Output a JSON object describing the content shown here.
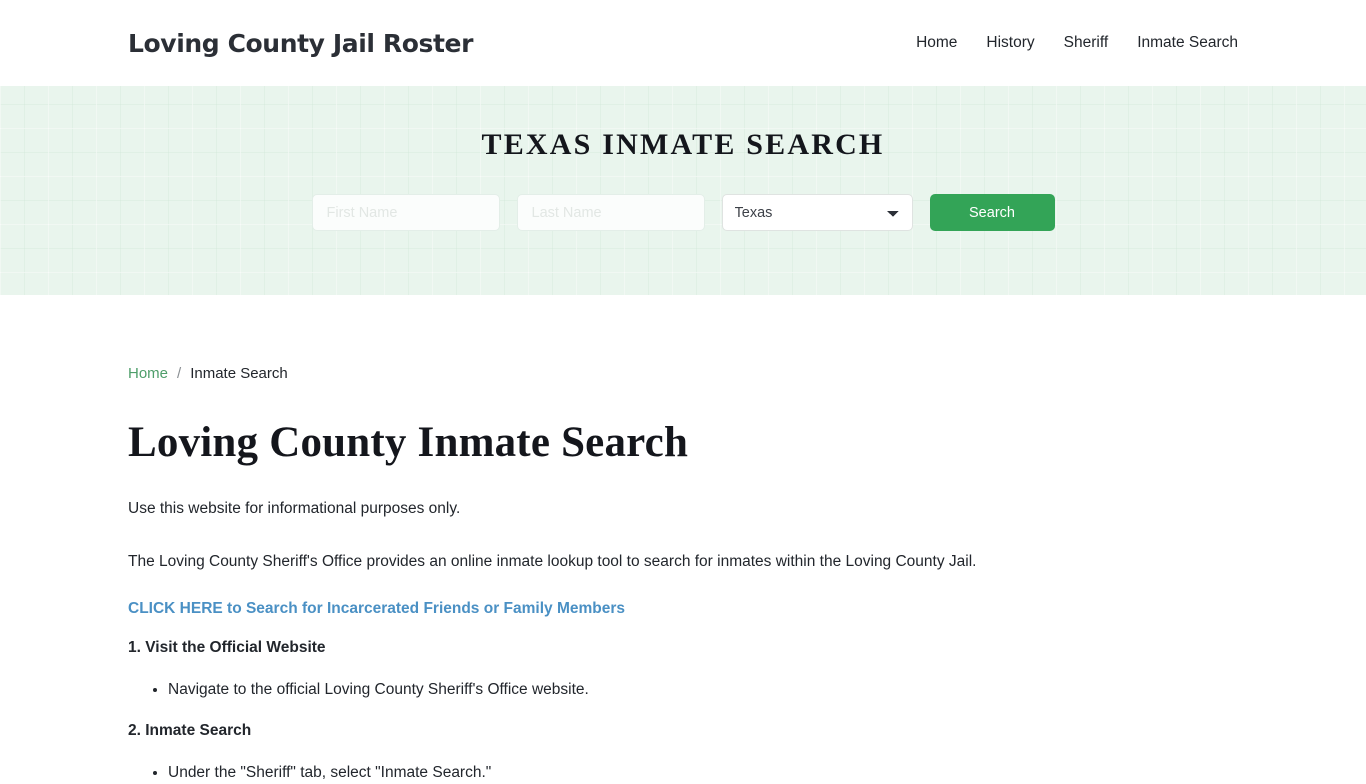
{
  "header": {
    "site_title": "Loving County Jail Roster",
    "nav": [
      {
        "label": "Home"
      },
      {
        "label": "History"
      },
      {
        "label": "Sheriff"
      },
      {
        "label": "Inmate Search"
      }
    ]
  },
  "hero": {
    "title": "TEXAS INMATE SEARCH",
    "first_name_placeholder": "First Name",
    "first_name_value": "",
    "last_name_placeholder": "Last Name",
    "last_name_value": "",
    "state_selected": "Texas",
    "state_options": [
      "Texas"
    ],
    "search_button": "Search",
    "accent_green": "#33a457",
    "background_color": "#e9f5ed"
  },
  "breadcrumb": {
    "home": "Home",
    "separator": "/",
    "current": "Inmate Search",
    "link_color": "#4e9e6a"
  },
  "main": {
    "page_title": "Loving County Inmate Search",
    "paragraph_1": "Use this website for informational purposes only.",
    "paragraph_2": "The Loving County Sheriff's Office provides an online inmate lookup tool to search for inmates within the Loving County Jail.",
    "cta_link": "CLICK HERE to Search for Incarcerated Friends or Family Members",
    "cta_color": "#4a90c4",
    "steps": [
      {
        "heading": "1. Visit the Official Website",
        "bullets": [
          "Navigate to the official Loving County Sheriff's Office website."
        ]
      },
      {
        "heading": "2. Inmate Search",
        "bullets": [
          "Under the \"Sheriff\" tab, select \"Inmate Search.\""
        ]
      }
    ]
  }
}
